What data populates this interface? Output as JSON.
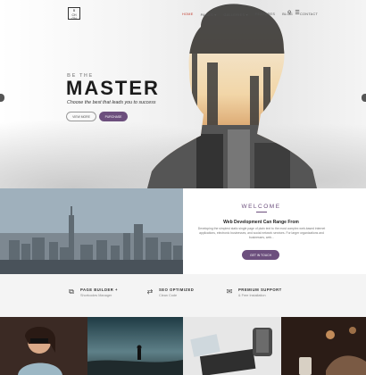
{
  "header": {
    "logo_lines": [
      "B",
      "CH",
      "GN"
    ],
    "nav": [
      {
        "label": "HOME",
        "active": true
      },
      {
        "label": "PAGES ▾",
        "active": false
      },
      {
        "label": "GALLERIES ▾",
        "active": false
      },
      {
        "label": "FEATURES",
        "active": false
      },
      {
        "label": "BLOG",
        "active": false
      },
      {
        "label": "CONTACT",
        "active": false
      }
    ]
  },
  "hero": {
    "kicker": "BE THE",
    "title": "MASTER",
    "subtitle": "Choose the best that leads you to success",
    "btn_view": "VIEW MORE",
    "btn_purchase": "PURCHASE"
  },
  "welcome": {
    "title": "WELCOME",
    "heading": "Web Development Can Range From",
    "body": "Developing the simplest static single page of plain text to the most complex web-based internet applications, electronic businesses, and social network services. For larger organizations and businesses, web...",
    "button": "GET IN TOUCH"
  },
  "features": [
    {
      "icon": "layout-icon",
      "glyph": "⧉",
      "title": "PAGE BUILDER +",
      "sub": "Shortcodes Manager"
    },
    {
      "icon": "code-icon",
      "glyph": "⇄",
      "title": "SEO OPTIMIZED",
      "sub": "Clean Code"
    },
    {
      "icon": "support-icon",
      "glyph": "✉",
      "title": "PREMIUM SUPPORT",
      "sub": "& Free Installation"
    }
  ],
  "colors": {
    "accent": "#6c4f7d",
    "nav_active": "#c0392b"
  }
}
